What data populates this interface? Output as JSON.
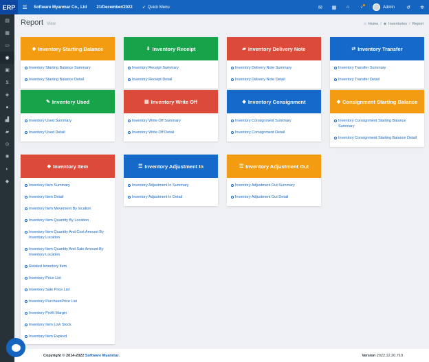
{
  "header": {
    "brand": "ERP",
    "company": "Software Myanmar Co., Ltd",
    "date": "21/December/2022",
    "quick_menu": "Quick Menu",
    "user": "Admin"
  },
  "page": {
    "title": "Report",
    "subtitle": "View"
  },
  "breadcrumb": {
    "home": "Home",
    "module": "Inventories",
    "current": "Report"
  },
  "cards": {
    "starting_balance": {
      "title": "Inventory Starting Balance",
      "links": [
        "Inventory Starting Balance Summary",
        "Inventory Starting Balance Detail"
      ]
    },
    "receipt": {
      "title": "Inventory Receipt",
      "links": [
        "Inventory Receipt Summary",
        "Inventory Receipt Detail"
      ]
    },
    "delivery_note": {
      "title": "Inventory Delivery Note",
      "links": [
        "Inventory Delivery Note Summary",
        "Inventory Delivery Note Detail"
      ]
    },
    "transfer": {
      "title": "Inventory Transfer",
      "links": [
        "Inventory Transfer Summary",
        "Inventory Transfer Detail"
      ]
    },
    "used": {
      "title": "Inventory Used",
      "links": [
        "Inventory Used Summary",
        "Inventory Used Detail"
      ]
    },
    "write_off": {
      "title": "Inventory Write Off",
      "links": [
        "Inventory Write Off Summary",
        "Inventory Write Off Detail"
      ]
    },
    "consignment": {
      "title": "Inventory Consignment",
      "links": [
        "Inventory Consignment Summary",
        "Inventory Consignment Detail"
      ]
    },
    "consignment_starting": {
      "title": "Consignment Starting Balance",
      "links": [
        "Inventory Consignment Starting Balance Summary",
        "Inventory Consignment Starting Balance Detail"
      ]
    },
    "item": {
      "title": "Inventory Item",
      "links": [
        "Inventory Item Summary",
        "Inventory Item Detail",
        "Inventory Item Movement By location",
        "Inventory Item Quantity By Location",
        "Inventory Item Quantity And Cost Amount By Inventory Location",
        "Inventory Item Quantity And Sale Amount By Inventory Location",
        "Related Inventory Item",
        "Inventory Price List",
        "Inventory Sale Price List",
        "Inventory PurchasePrice List",
        "Inventory Profit Margin",
        "Inventory Item Low Stock",
        "Inventory Item Expired"
      ]
    },
    "adjustment_in": {
      "title": "Inventory Adjustment In",
      "links": [
        "Inventory Adjustment In Summary",
        "Inventory Adjustment In Detail"
      ]
    },
    "adjustment_out": {
      "title": "Inventory Adjustment Out",
      "links": [
        "Inventory Adjustment Out Summary",
        "Inventory Adjustment Out Detail"
      ]
    }
  },
  "footer": {
    "copyright": "Copyright © 2014-2022",
    "company": "Software Myanmar.",
    "version_label": "Version",
    "version": "2022.12.20.710"
  }
}
